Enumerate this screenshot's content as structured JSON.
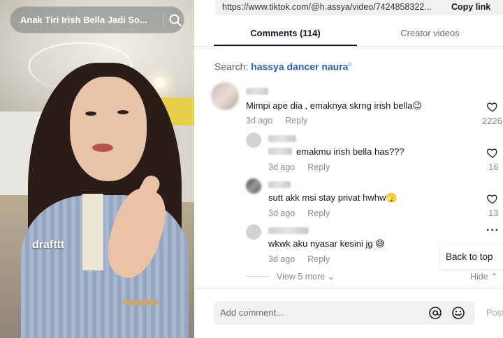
{
  "video": {
    "search_query": "Anak Tiri Irish Bella Jadi So...",
    "caption": "drafttt"
  },
  "browser": {
    "url": "https://www.tiktok.com/@h.assya/video/7424858322...",
    "copy_link": "Copy link"
  },
  "tabs": {
    "comments": "Comments (114)",
    "creator_videos": "Creator videos"
  },
  "search": {
    "prefix": "Search:",
    "term": "hassya dancer naura"
  },
  "comments": [
    {
      "text": "Mimpi ape dia , emaknya skrng irish bella😉",
      "time": "3d ago",
      "reply": "Reply",
      "likes": "2226"
    },
    {
      "text": "emakmu irish bella has???",
      "time": "3d ago",
      "reply": "Reply",
      "likes": "16"
    },
    {
      "text": "sutt akk msi stay privat hwhw🫣",
      "time": "3d ago",
      "reply": "Reply",
      "likes": "13"
    },
    {
      "text": "wkwk aku nyasar kesini jg 😅",
      "time": "3d ago",
      "reply": "Reply",
      "likes": ""
    }
  ],
  "thread": {
    "view_more": "View 5 more",
    "hide": "Hide"
  },
  "back_to_top": "Back to top",
  "composer": {
    "placeholder": "Add comment...",
    "post": "Post"
  }
}
